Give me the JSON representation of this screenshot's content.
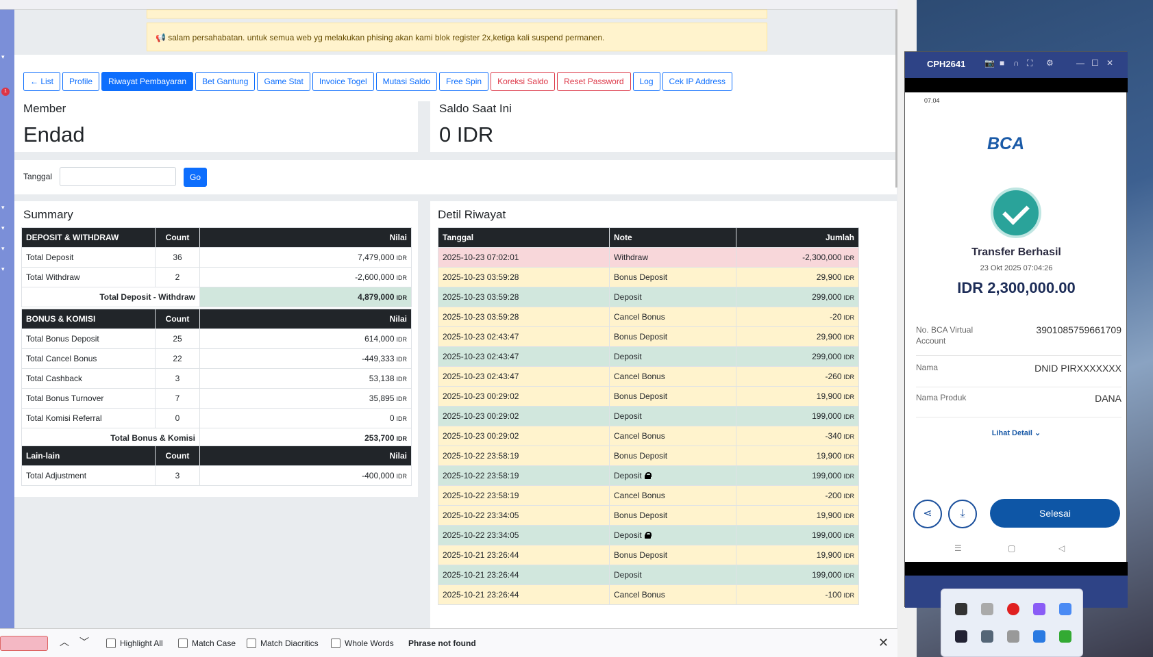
{
  "notice": {
    "text": "salam persahabatan. untuk semua web yg melakukan phising akan kami blok register 2x,ketiga kali suspend permanen."
  },
  "nav": {
    "buttons": [
      {
        "label": "← List"
      },
      {
        "label": "Profile"
      },
      {
        "label": "Riwayat Pembayaran"
      },
      {
        "label": "Bet Gantung"
      },
      {
        "label": "Game Stat"
      },
      {
        "label": "Invoice Togel"
      },
      {
        "label": "Mutasi Saldo"
      },
      {
        "label": "Free Spin"
      },
      {
        "label": "Koreksi Saldo"
      },
      {
        "label": "Reset Password"
      },
      {
        "label": "Log"
      },
      {
        "label": "Cek IP Address"
      }
    ]
  },
  "member": {
    "label": "Member",
    "name": "Endad"
  },
  "saldo": {
    "label": "Saldo Saat Ini",
    "value": "0 IDR"
  },
  "filter": {
    "label": "Tanggal",
    "value": "",
    "go": "Go"
  },
  "summary": {
    "title": "Summary",
    "count_header": "Count",
    "value_header": "Nilai",
    "currency": "IDR",
    "deposit": {
      "header": "DEPOSIT & WITHDRAW",
      "rows": [
        {
          "label": "Total Deposit",
          "count": "36",
          "value": "7,479,000"
        },
        {
          "label": "Total Withdraw",
          "count": "2",
          "value": "-2,600,000"
        }
      ],
      "total_label": "Total Deposit - Withdraw",
      "total_value": "4,879,000"
    },
    "bonus": {
      "header": "BONUS & KOMISI",
      "rows": [
        {
          "label": "Total Bonus Deposit",
          "count": "25",
          "value": "614,000"
        },
        {
          "label": "Total Cancel Bonus",
          "count": "22",
          "value": "-449,333"
        },
        {
          "label": "Total Cashback",
          "count": "3",
          "value": "53,138"
        },
        {
          "label": "Total Bonus Turnover",
          "count": "7",
          "value": "35,895"
        },
        {
          "label": "Total Komisi Referral",
          "count": "0",
          "value": "0"
        }
      ],
      "total_label": "Total Bonus & Komisi",
      "total_value": "253,700"
    },
    "other": {
      "header": "Lain-lain",
      "rows": [
        {
          "label": "Total Adjustment",
          "count": "3",
          "value": "-400,000"
        }
      ]
    }
  },
  "detail": {
    "title": "Detil Riwayat",
    "headers": {
      "date": "Tanggal",
      "note": "Note",
      "amount": "Jumlah"
    },
    "currency": "IDR",
    "rows": [
      {
        "date": "2025-10-23 07:02:01",
        "note": "Withdraw",
        "amount": "-2,300,000",
        "status": "red",
        "locked": false
      },
      {
        "date": "2025-10-23 03:59:28",
        "note": "Bonus Deposit",
        "amount": "29,900",
        "status": "yellow",
        "locked": false
      },
      {
        "date": "2025-10-23 03:59:28",
        "note": "Deposit",
        "amount": "299,000",
        "status": "green",
        "locked": false
      },
      {
        "date": "2025-10-23 03:59:28",
        "note": "Cancel Bonus",
        "amount": "-20",
        "status": "yellow",
        "locked": false
      },
      {
        "date": "2025-10-23 02:43:47",
        "note": "Bonus Deposit",
        "amount": "29,900",
        "status": "yellow",
        "locked": false
      },
      {
        "date": "2025-10-23 02:43:47",
        "note": "Deposit",
        "amount": "299,000",
        "status": "green",
        "locked": false
      },
      {
        "date": "2025-10-23 02:43:47",
        "note": "Cancel Bonus",
        "amount": "-260",
        "status": "yellow",
        "locked": false
      },
      {
        "date": "2025-10-23 00:29:02",
        "note": "Bonus Deposit",
        "amount": "19,900",
        "status": "yellow",
        "locked": false
      },
      {
        "date": "2025-10-23 00:29:02",
        "note": "Deposit",
        "amount": "199,000",
        "status": "green",
        "locked": false
      },
      {
        "date": "2025-10-23 00:29:02",
        "note": "Cancel Bonus",
        "amount": "-340",
        "status": "yellow",
        "locked": false
      },
      {
        "date": "2025-10-22 23:58:19",
        "note": "Bonus Deposit",
        "amount": "19,900",
        "status": "yellow",
        "locked": false
      },
      {
        "date": "2025-10-22 23:58:19",
        "note": "Deposit",
        "amount": "199,000",
        "status": "green",
        "locked": true
      },
      {
        "date": "2025-10-22 23:58:19",
        "note": "Cancel Bonus",
        "amount": "-200",
        "status": "yellow",
        "locked": false
      },
      {
        "date": "2025-10-22 23:34:05",
        "note": "Bonus Deposit",
        "amount": "19,900",
        "status": "yellow",
        "locked": false
      },
      {
        "date": "2025-10-22 23:34:05",
        "note": "Deposit",
        "amount": "199,000",
        "status": "green",
        "locked": true
      },
      {
        "date": "2025-10-21 23:26:44",
        "note": "Bonus Deposit",
        "amount": "19,900",
        "status": "yellow",
        "locked": false
      },
      {
        "date": "2025-10-21 23:26:44",
        "note": "Deposit",
        "amount": "199,000",
        "status": "green",
        "locked": false
      },
      {
        "date": "2025-10-21 23:26:44",
        "note": "Cancel Bonus",
        "amount": "-100",
        "status": "yellow",
        "locked": false
      }
    ]
  },
  "findbar": {
    "value": "",
    "options": [
      "Highlight All",
      "Match Case",
      "Match Diacritics",
      "Whole Words"
    ],
    "status": "Phrase not found"
  },
  "phone": {
    "window_title": "CPH2641",
    "status_time": "07.04",
    "brand": "BCA",
    "result_title": "Transfer Berhasil",
    "datetime": "23 Okt 2025 07:04:26",
    "amount": "IDR 2,300,000.00",
    "fields": [
      {
        "label": "No. BCA Virtual Account",
        "value": "3901085759661709"
      },
      {
        "label": "Nama",
        "value": "DNID PIRXXXXXXX"
      },
      {
        "label": "Nama Produk",
        "value": "DANA"
      }
    ],
    "detail_link": "Lihat Detail",
    "done_button": "Selesai"
  }
}
